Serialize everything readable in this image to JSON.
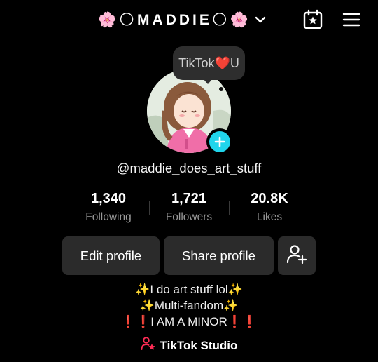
{
  "header": {
    "title": "🌸🌕MADDIE🌕🌸",
    "dropdown_icon": "chevron-down-icon",
    "calendar_icon": "calendar-star-icon",
    "menu_icon": "hamburger-menu-icon"
  },
  "profile": {
    "note_bubble": "TikTok❤️U",
    "username": "@maddie_does_art_stuff",
    "avatar_icon": "avatar-image",
    "add_icon": "plus-icon"
  },
  "stats": [
    {
      "value": "1,340",
      "label": "Following"
    },
    {
      "value": "1,721",
      "label": "Followers"
    },
    {
      "value": "20.8K",
      "label": "Likes"
    }
  ],
  "actions": {
    "edit_label": "Edit profile",
    "share_label": "Share profile",
    "add_friends_icon": "add-user-icon"
  },
  "bio": {
    "line1": "✨I do art stuff lol✨",
    "line2": "✨Multi-fandom✨",
    "line3": "❗❗I AM A MINOR❗❗"
  },
  "studio": {
    "label": "TikTok Studio",
    "icon": "person-star-icon"
  },
  "colors": {
    "background": "#000000",
    "button_bg": "#2b2b2b",
    "accent_cyan": "#20d5ec",
    "accent_pink": "#fe2c55",
    "secondary_text": "#9a9a9a"
  }
}
